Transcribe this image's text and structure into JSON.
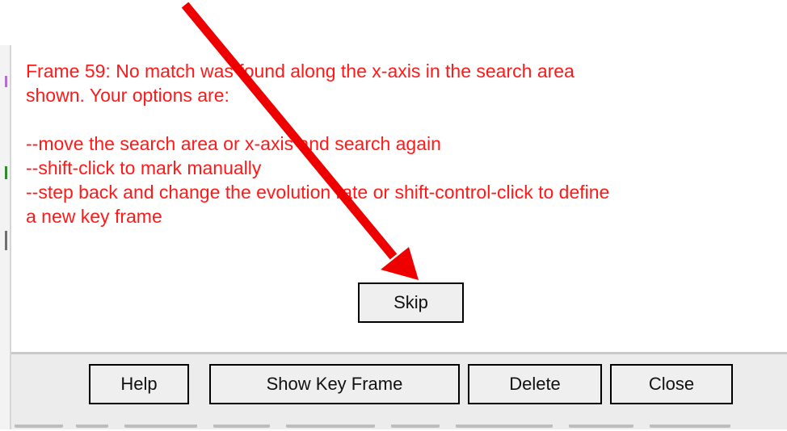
{
  "message": {
    "lines": [
      "Frame 59: No match was found along the x-axis in the search area",
      "shown. Your options are:",
      "",
      "--move the search area or x-axis and search again",
      "--shift-click to mark manually",
      "--step back and change the evolution rate or shift-control-click to define",
      "a new key frame"
    ],
    "color": "#ff1a1a"
  },
  "skip_button": {
    "label": "Skip"
  },
  "toolbar": {
    "help_label": "Help",
    "show_key_frame_label": "Show Key Frame",
    "delete_label": "Delete",
    "close_label": "Close"
  },
  "annotation": {
    "arrow_color": "#ee0000"
  }
}
